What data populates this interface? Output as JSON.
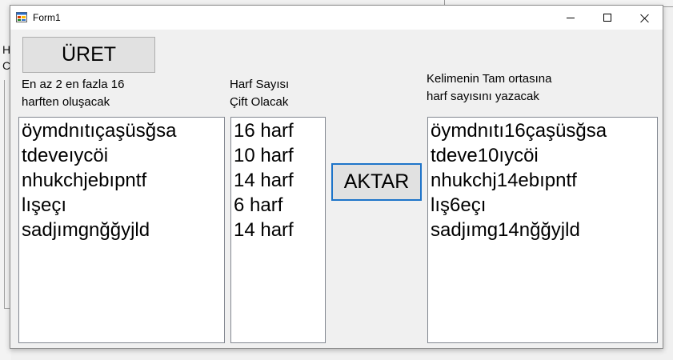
{
  "window": {
    "title": "Form1"
  },
  "background": {
    "letters": [
      "H",
      "C"
    ]
  },
  "buttons": {
    "generate": "ÜRET",
    "transfer": "AKTAR"
  },
  "labels": {
    "left": [
      "En az 2 en fazla 16",
      "harften oluşacak"
    ],
    "middle": [
      "Harf Sayısı",
      "Çift Olacak"
    ],
    "right": [
      "Kelimenin Tam ortasına",
      "harf sayısını yazacak"
    ]
  },
  "lists": {
    "words": [
      "öymdnıtıçaşüsğsa",
      "tdeveıycöi",
      "nhukchjebıpntf",
      "lışeçı",
      "sadjımgnğğyjld"
    ],
    "letter_counts": [
      "16 harf",
      "10 harf",
      "14 harf",
      "6 harf",
      "14 harf"
    ],
    "results": [
      "öymdnıtı16çaşüsğsa",
      "tdeve10ıycöi",
      "nhukchj14ebıpntf",
      "lış6eçı",
      "sadjımg14nğğyjld"
    ]
  },
  "colors": {
    "focus_border": "#1e74c9",
    "button_face": "#e1e1e1",
    "form_background": "#f0f0f0"
  }
}
